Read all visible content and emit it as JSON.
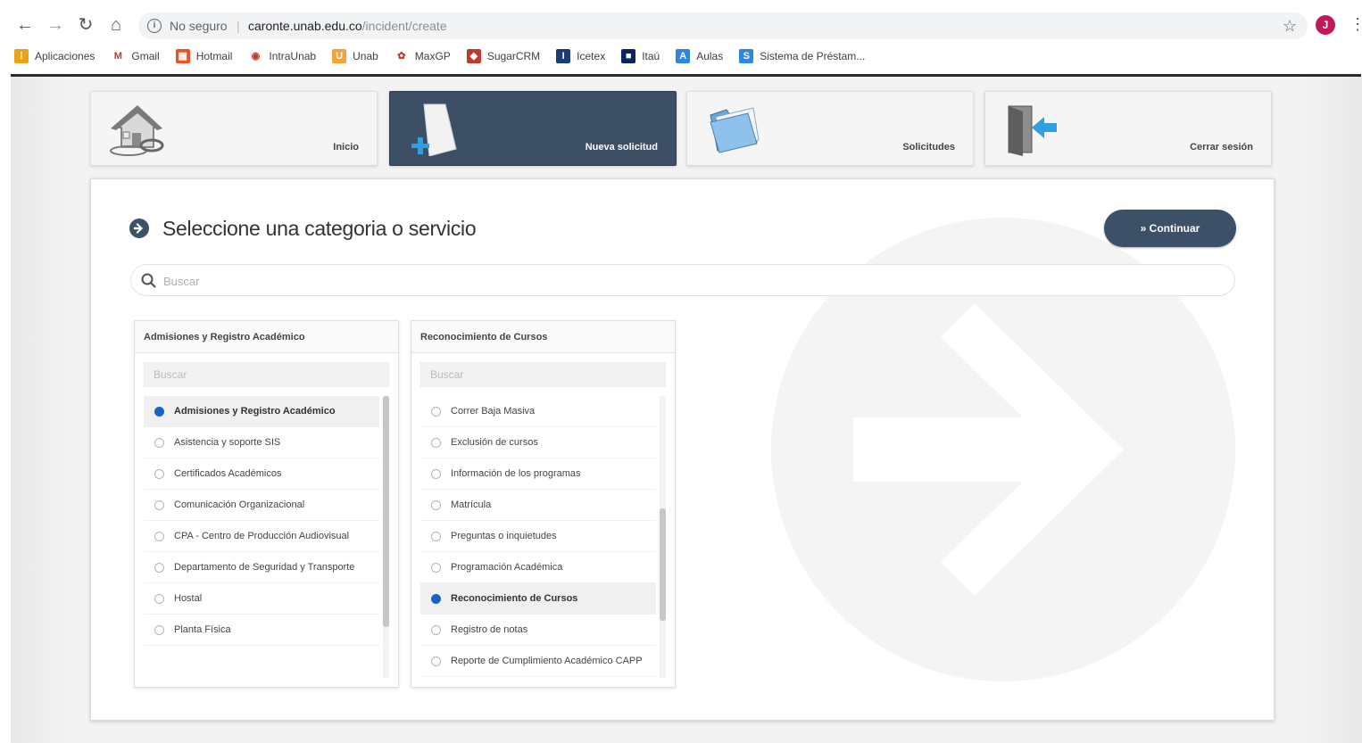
{
  "browser": {
    "back_glyph": "←",
    "forward_glyph": "→",
    "reload_glyph": "↻",
    "home_glyph": "⌂",
    "security_label": "No seguro",
    "url_host": "caronte.unab.edu.co",
    "url_path": "/incident/create",
    "star_glyph": "☆",
    "profile_initial": "J",
    "menu_glyph": "⋮",
    "bookmarks": [
      {
        "label": "Aplicaciones",
        "icon": "apps-grid-icon",
        "color": "#e8a317",
        "glyph": "⁞"
      },
      {
        "label": "Gmail",
        "icon": "gmail-icon",
        "color": "#ffffff",
        "glyph": "M"
      },
      {
        "label": "Hotmail",
        "icon": "hotmail-icon",
        "color": "#f25022",
        "glyph": "▦"
      },
      {
        "label": "IntraUnab",
        "icon": "globe-icon",
        "color": "#ffffff",
        "glyph": "◉"
      },
      {
        "label": "Unab",
        "icon": "unab-icon",
        "color": "#f4a23c",
        "glyph": "U"
      },
      {
        "label": "MaxGP",
        "icon": "maxgp-icon",
        "color": "#ffffff",
        "glyph": "✿"
      },
      {
        "label": "SugarCRM",
        "icon": "sugarcrm-icon",
        "color": "#c0392b",
        "glyph": "◆"
      },
      {
        "label": "Icetex",
        "icon": "icetex-icon",
        "color": "#1f3b73",
        "glyph": "I"
      },
      {
        "label": "Itaú",
        "icon": "itau-icon",
        "color": "#0a2463",
        "glyph": "■"
      },
      {
        "label": "Aulas",
        "icon": "aulas-icon",
        "color": "#2e86de",
        "glyph": "A"
      },
      {
        "label": "Sistema de Préstam...",
        "icon": "prestamo-icon",
        "color": "#2e86de",
        "glyph": "S"
      }
    ]
  },
  "tiles": [
    {
      "label": "Inicio",
      "icon": "home-icon",
      "active": false
    },
    {
      "label": "Nueva solicitud",
      "icon": "new-document-icon",
      "active": true
    },
    {
      "label": "Solicitudes",
      "icon": "folder-icon",
      "active": false
    },
    {
      "label": "Cerrar sesión",
      "icon": "logout-door-icon",
      "active": false
    }
  ],
  "main": {
    "title": "Seleccione una categoria o servicio",
    "continue_label": "» Continuar",
    "search_placeholder": "Buscar"
  },
  "columns": [
    {
      "header": "Admisiones y Registro Académico",
      "search_placeholder": "Buscar",
      "scroll_thumb": {
        "start": 0.0,
        "length": 0.82
      },
      "items": [
        {
          "label": "Admisiones y Registro Académico",
          "selected": true
        },
        {
          "label": "Asistencia y soporte SIS",
          "selected": false
        },
        {
          "label": "Certificados Académicos",
          "selected": false
        },
        {
          "label": "Comunicación Organizacional",
          "selected": false
        },
        {
          "label": "CPA - Centro de Producción Audiovisual",
          "selected": false
        },
        {
          "label": "Departamento de Seguridad y Transporte",
          "selected": false
        },
        {
          "label": "Hostal",
          "selected": false
        },
        {
          "label": "Planta Física",
          "selected": false
        }
      ]
    },
    {
      "header": "Reconocimiento de Cursos",
      "search_placeholder": "Buscar",
      "scroll_thumb": {
        "start": 0.4,
        "length": 0.4
      },
      "items": [
        {
          "label": "Correr Baja Masiva",
          "selected": false
        },
        {
          "label": "Exclusión de cursos",
          "selected": false
        },
        {
          "label": "Información de los programas",
          "selected": false
        },
        {
          "label": "Matrícula",
          "selected": false
        },
        {
          "label": "Preguntas o inquietudes",
          "selected": false
        },
        {
          "label": "Programación Académica",
          "selected": false
        },
        {
          "label": "Reconocimiento de Cursos",
          "selected": true
        },
        {
          "label": "Registro de notas",
          "selected": false
        },
        {
          "label": "Reporte de Cumplimiento Académico CAPP",
          "selected": false
        }
      ]
    }
  ],
  "colors": {
    "accent": "#3c5068",
    "active_tile": "#3c4f64",
    "radio_selected": "#1565c0"
  }
}
